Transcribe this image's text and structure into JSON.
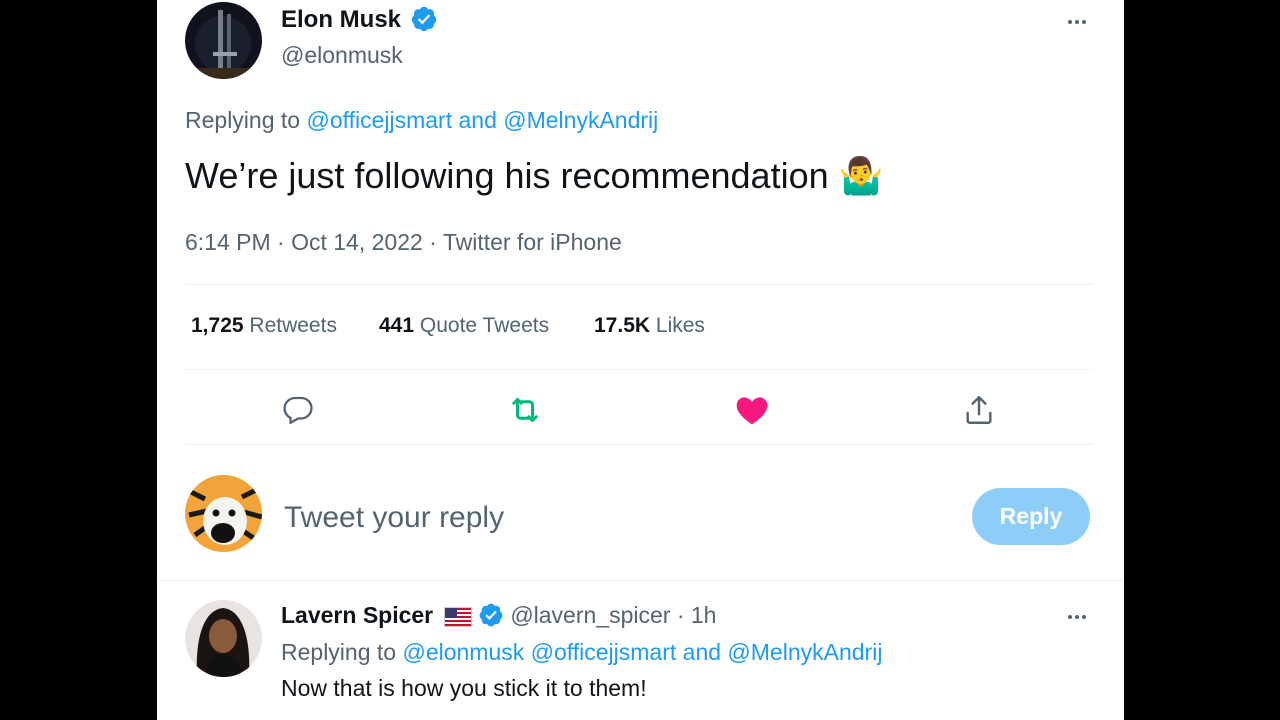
{
  "main_tweet": {
    "author_name": "Elon Musk",
    "author_handle": "@elonmusk",
    "replying_prefix": "Replying to",
    "replying_to": "@officejjsmart and @MelnykAndrij",
    "text": "We’re just following his recommendation",
    "emoji": "🤷‍♂️",
    "timestamp": "6:14 PM · Oct 14, 2022 · Twitter for iPhone"
  },
  "stats": {
    "retweets_count": "1,725",
    "retweets_label": "Retweets",
    "quotes_count": "441",
    "quotes_label": "Quote Tweets",
    "likes_count": "17.5K",
    "likes_label": "Likes"
  },
  "actions": {
    "reply_icon": "comment-icon",
    "retweet_icon": "retweet-icon",
    "like_icon": "heart-icon",
    "share_icon": "share-icon"
  },
  "composer": {
    "placeholder": "Tweet your reply",
    "reply_button": "Reply"
  },
  "reply_tweet": {
    "author_name": "Lavern Spicer",
    "author_handle": "@lavern_spicer",
    "time": "· 1h",
    "replying_prefix": "Replying to",
    "replying_to": "@elonmusk @officejjsmart and @MelnykAndrij",
    "text": "Now that is how you stick it to them!"
  },
  "colors": {
    "accent": "#1d9bf0",
    "retweet_green": "#00ba7c",
    "like_pink": "#f91880",
    "muted": "#536471",
    "reply_button_disabled": "#8ecdf8"
  }
}
